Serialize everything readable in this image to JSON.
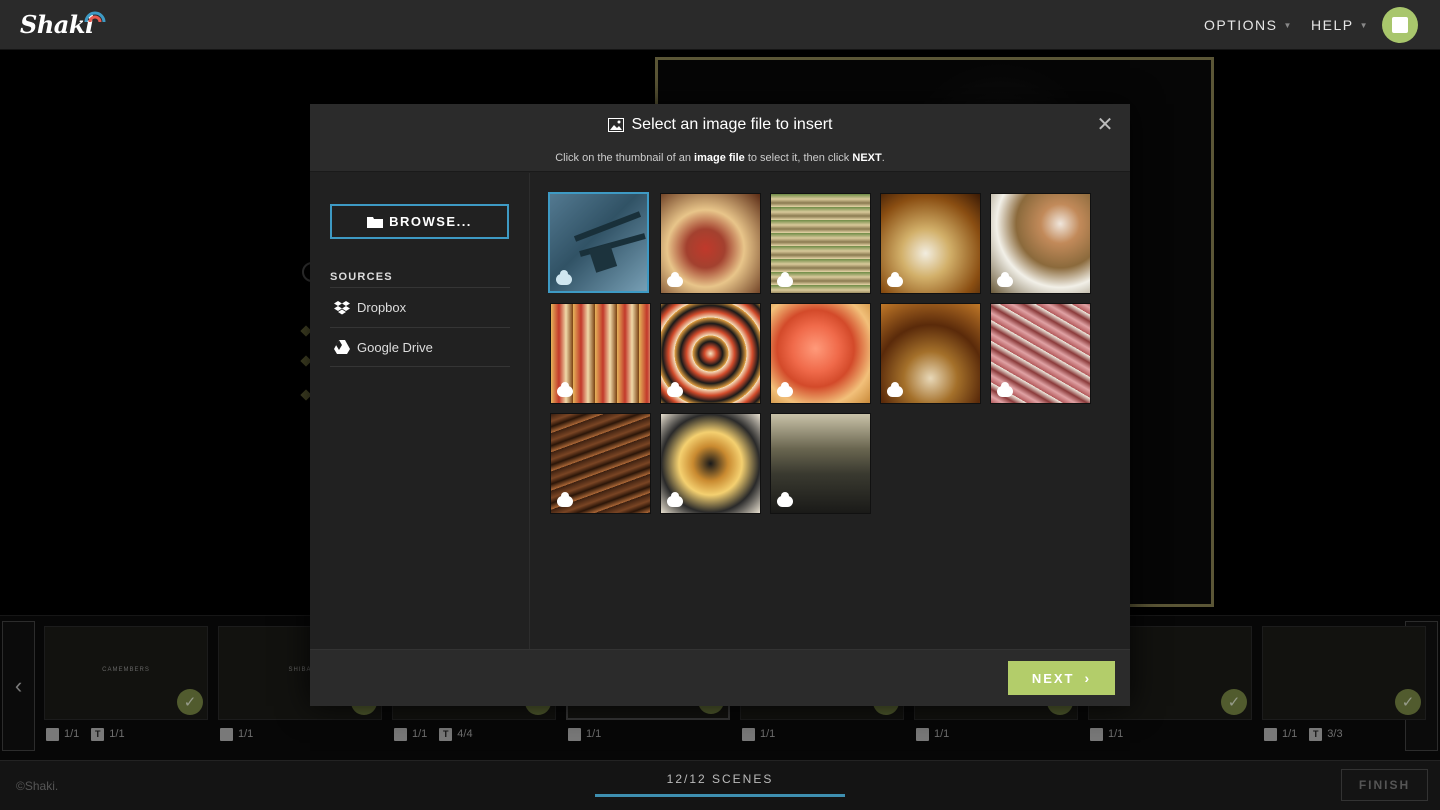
{
  "app": {
    "logo_text": "Shaki"
  },
  "nav": {
    "options_label": "OPTIONS",
    "help_label": "HELP"
  },
  "modal": {
    "title": "Select an image file to insert",
    "subtitle_pre": "Click on the thumbnail of an ",
    "subtitle_bold1": "image file",
    "subtitle_mid": " to select it, then click ",
    "subtitle_bold2": "NEXT",
    "subtitle_end": ".",
    "browse_label": "BROWSE...",
    "sources_label": "SOURCES",
    "sources": [
      {
        "label": "Dropbox",
        "icon": "dropbox-icon"
      },
      {
        "label": "Google Drive",
        "icon": "google-drive-icon"
      }
    ],
    "next_label": "NEXT",
    "thumbnails": [
      {
        "subject": "chopsticks",
        "selected": true
      },
      {
        "subject": "tuna roll"
      },
      {
        "subject": "stacked plates"
      },
      {
        "subject": "tempura bowl"
      },
      {
        "subject": "dipping sauces"
      },
      {
        "subject": "sushi platter"
      },
      {
        "subject": "sushi rolls"
      },
      {
        "subject": "salmon nigiri"
      },
      {
        "subject": "ramen"
      },
      {
        "subject": "raw beef slices"
      },
      {
        "subject": "grilled beef"
      },
      {
        "subject": "okonomiyaki"
      },
      {
        "subject": "restaurant interior"
      }
    ]
  },
  "filmstrip": {
    "scenes": [
      {
        "caption": "CAMEMBERS",
        "image": "1/1",
        "text": "1/1",
        "checked": true
      },
      {
        "caption": "SHIBA",
        "image": "1/1",
        "text": "",
        "checked": true
      },
      {
        "caption": "",
        "image": "1/1",
        "text": "4/4",
        "checked": true
      },
      {
        "caption": "",
        "image": "1/1",
        "text": "",
        "checked": true,
        "active": true
      },
      {
        "caption": "",
        "image": "1/1",
        "text": "",
        "checked": true
      },
      {
        "caption": "",
        "image": "1/1",
        "text": "",
        "checked": true
      },
      {
        "caption": "",
        "image": "1/1",
        "text": "",
        "checked": true
      },
      {
        "caption": "",
        "image": "1/1",
        "text": "3/3",
        "checked": true
      }
    ]
  },
  "footer": {
    "copyright": "©Shaki.",
    "scene_count": "12/12 SCENES",
    "progress": 1.0,
    "finish_label": "FINISH"
  },
  "colors": {
    "accent_blue": "#3e9ac4",
    "accent_green": "#b3cd6a",
    "topbar": "#2a2a2a"
  }
}
